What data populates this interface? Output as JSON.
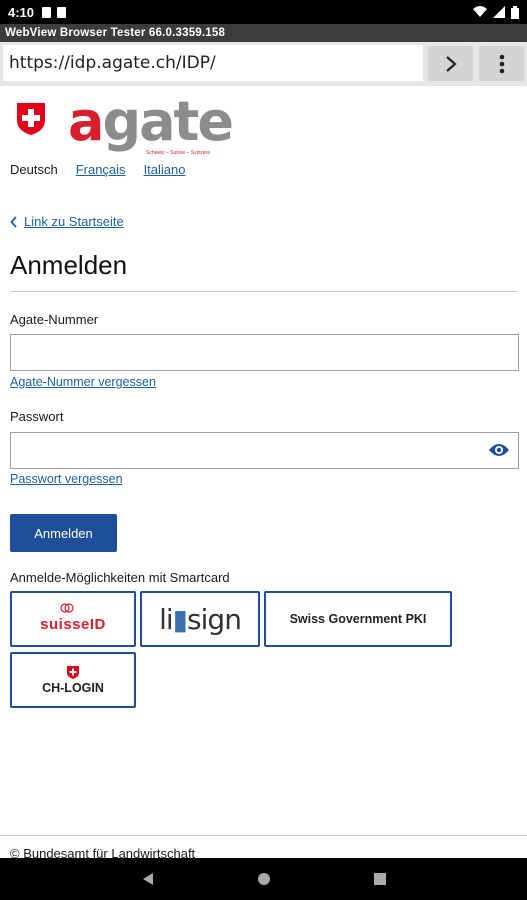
{
  "status": {
    "time": "4:10"
  },
  "app": {
    "title": "WebView Browser Tester 66.0.3359.158"
  },
  "browser": {
    "url": "https://idp.agate.ch/IDP/"
  },
  "logo": {
    "wordmark_a": "a",
    "wordmark_rest": "gate",
    "tagline": "Schweiz – Suisse – Svizzera"
  },
  "languages": [
    {
      "label": "Deutsch",
      "active": true
    },
    {
      "label": "Français",
      "active": false
    },
    {
      "label": "Italiano",
      "active": false
    }
  ],
  "home_link": "Link zu Startseite",
  "page_title": "Anmelden",
  "form": {
    "agate_label": "Agate-Nummer",
    "agate_value": "",
    "agate_forgot": "Agate-Nummer vergessen",
    "password_label": "Passwort",
    "password_value": "",
    "password_forgot": "Passwort vergessen",
    "submit_label": "Anmelden"
  },
  "smartcard": {
    "title": "Anmelde-Möglichkeiten mit Smartcard",
    "suisseid": "suisseID",
    "lisign_pre": "li",
    "lisign_post": "sign",
    "pki": "Swiss Government PKI",
    "chlogin": "CH-LOGIN"
  },
  "footer": {
    "text": "© Bundesamt für Landwirtschaft"
  },
  "colors": {
    "brand_red": "#d7202e",
    "link_blue": "#1d5fa8",
    "button_blue": "#1f4e9b"
  }
}
